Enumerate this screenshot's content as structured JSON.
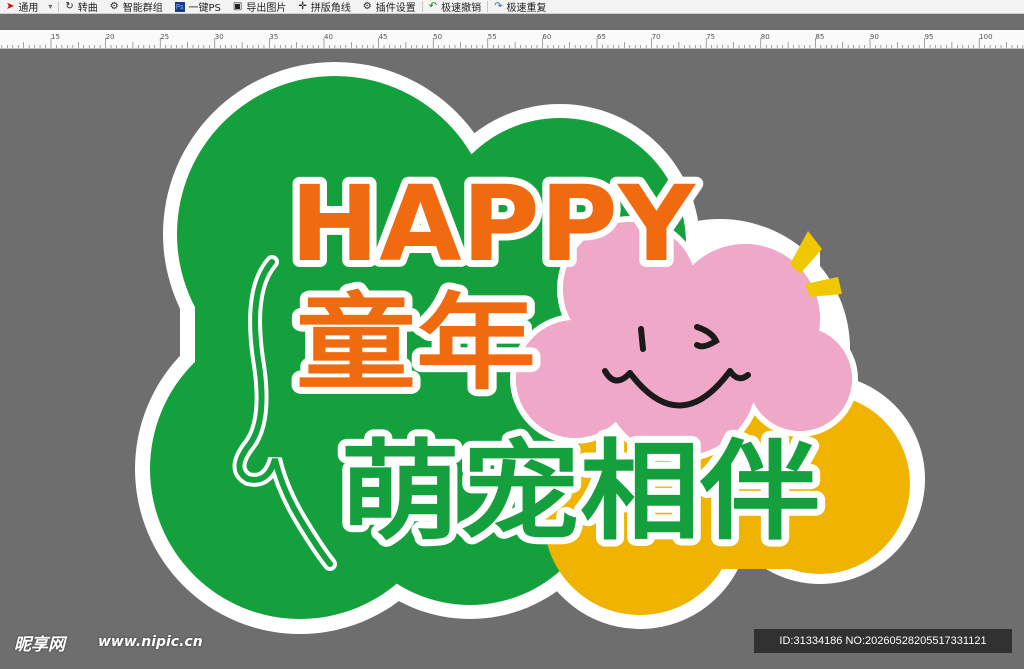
{
  "toolbar": {
    "items": [
      {
        "icon": "arrow-icon",
        "label": "通用"
      },
      {
        "icon": "curve-icon",
        "label": "转曲"
      },
      {
        "icon": "group-icon",
        "label": "智能群组"
      },
      {
        "icon": "ps-icon",
        "label": "一键PS"
      },
      {
        "icon": "image-icon",
        "label": "导出图片"
      },
      {
        "icon": "crop-icon",
        "label": "拼版角线"
      },
      {
        "icon": "gear-icon",
        "label": "插件设置"
      },
      {
        "icon": "undo-icon",
        "label": "极速撤销"
      },
      {
        "icon": "redo-icon",
        "label": "极速重复"
      }
    ]
  },
  "ruler": {
    "ticks": [
      "15",
      "20",
      "25",
      "30",
      "35",
      "40",
      "45",
      "50",
      "55",
      "60",
      "65",
      "70",
      "75",
      "80",
      "85",
      "90",
      "95",
      "100"
    ]
  },
  "artwork": {
    "title": "HAPPY",
    "line2": "童年",
    "line3": "萌宠相伴",
    "colors": {
      "green": "#14a03c",
      "orange": "#f06a10",
      "yellow": "#f0b400",
      "pink": "#efa8c8"
    }
  },
  "watermark": {
    "logo": "昵享网",
    "url": "www.nipic.cn",
    "id_text": "ID:31334186 NO:20260528205517331121"
  }
}
